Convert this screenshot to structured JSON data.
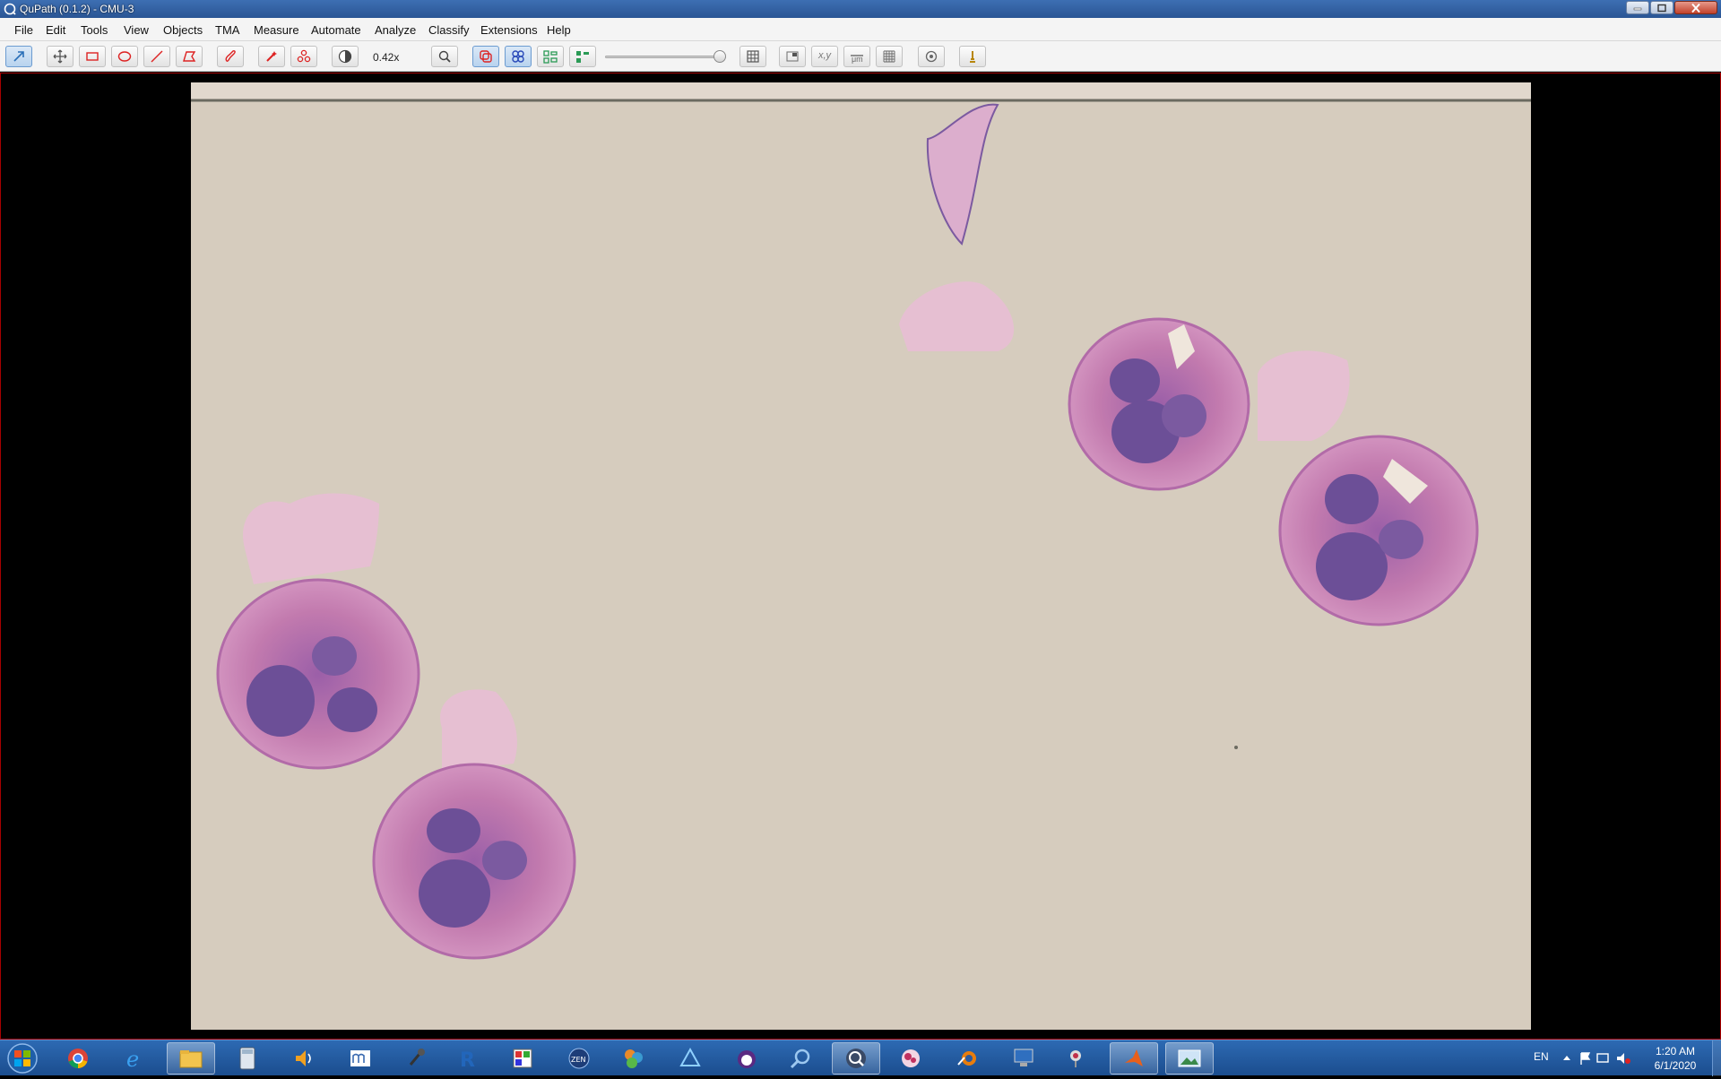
{
  "window": {
    "title": "QuPath (0.1.2) - CMU-3"
  },
  "menu": {
    "items": [
      "File",
      "Edit",
      "Tools",
      "View",
      "Objects",
      "TMA",
      "Measure",
      "Automate",
      "Analyze",
      "Classify",
      "Extensions",
      "Help"
    ]
  },
  "toolbar": {
    "zoom_label": "0.42x",
    "opacity_level": 1.0,
    "tools": [
      {
        "name": "move-tool-icon",
        "selected": true
      },
      {
        "name": "pan-icon",
        "selected": false
      },
      {
        "name": "rectangle-tool-icon",
        "selected": false
      },
      {
        "name": "ellipse-tool-icon",
        "selected": false
      },
      {
        "name": "line-tool-icon",
        "selected": false
      },
      {
        "name": "polygon-tool-icon",
        "selected": false
      },
      {
        "name": "brush-tool-icon",
        "selected": false
      },
      {
        "name": "wand-tool-icon",
        "selected": false
      },
      {
        "name": "points-tool-icon",
        "selected": false
      },
      {
        "name": "brightness-contrast-icon",
        "selected": false
      },
      {
        "name": "zoom-to-fit-icon",
        "selected": false
      },
      {
        "name": "show-annotations-icon",
        "selected": true
      },
      {
        "name": "show-tma-grid-icon",
        "selected": true
      },
      {
        "name": "show-detections-icon",
        "selected": false
      },
      {
        "name": "fill-detections-icon",
        "selected": false
      },
      {
        "name": "measurement-table-icon",
        "selected": false
      },
      {
        "name": "show-overview-icon",
        "selected": false
      },
      {
        "name": "show-cursor-location-icon",
        "selected": false
      },
      {
        "name": "show-scalebar-icon",
        "selected": false
      },
      {
        "name": "show-grid-icon",
        "selected": false
      },
      {
        "name": "preferences-icon",
        "selected": false
      },
      {
        "name": "log-icon",
        "selected": false
      }
    ],
    "cursor_location_label": "x,y",
    "scalebar_label": "μm"
  },
  "viewer": {
    "image_name": "CMU-3",
    "background_color": "#d6ccbe",
    "stain_color": "#c97ab0",
    "border_color": "#a80000"
  },
  "taskbar": {
    "apps": [
      {
        "name": "chrome-icon",
        "active": false
      },
      {
        "name": "internet-explorer-icon",
        "active": false
      },
      {
        "name": "file-explorer-icon",
        "active": true
      },
      {
        "name": "calculator-icon",
        "active": false
      },
      {
        "name": "speaker-icon",
        "active": false
      },
      {
        "name": "app-icon",
        "active": false
      },
      {
        "name": "microphone-icon",
        "active": false
      },
      {
        "name": "r-icon",
        "active": false
      },
      {
        "name": "paint-icon",
        "active": false
      },
      {
        "name": "zen-icon",
        "active": false
      },
      {
        "name": "hex-app-icon",
        "active": false
      },
      {
        "name": "prism-icon",
        "active": false
      },
      {
        "name": "cat-app-icon",
        "active": false
      },
      {
        "name": "search-app-icon",
        "active": false
      },
      {
        "name": "qupath-icon",
        "active": true
      },
      {
        "name": "slide-app-icon",
        "active": false
      },
      {
        "name": "blender-icon",
        "active": false
      },
      {
        "name": "computer-icon",
        "active": false
      },
      {
        "name": "microscope-icon",
        "active": false
      },
      {
        "name": "matlab-icon",
        "active": true
      },
      {
        "name": "image-viewer-icon",
        "active": true
      }
    ],
    "tray_language": "EN",
    "clock_time": "1:20 AM",
    "clock_date": "6/1/2020"
  }
}
